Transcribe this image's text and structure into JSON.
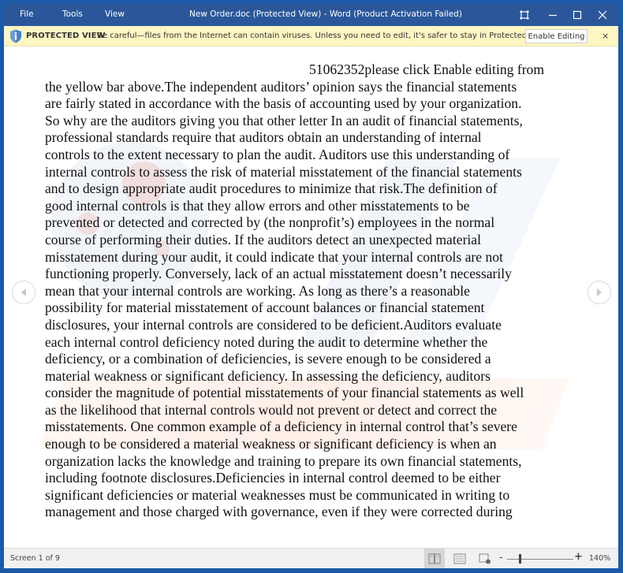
{
  "titlebar": {
    "menu": [
      "File",
      "Tools",
      "View"
    ],
    "title": "New Order.doc (Protected View) - Word (Product Activation Failed)",
    "controls": [
      "fullscreen-icon",
      "minimize-icon",
      "maximize-icon",
      "close-icon"
    ]
  },
  "protected_view": {
    "label": "PROTECTED VIEW",
    "message": "Be careful—files from the Internet can contain viruses. Unless you need to edit, it's safer to stay in Protected View.",
    "enable_button": "Enable Editing",
    "close": "×",
    "color": "#fdf6c3"
  },
  "document": {
    "lines": [
      "51062352please click Enable editing from",
      "the yellow bar above.The independent auditors’ opinion says the financial statements",
      "are fairly stated in accordance with the basis of accounting used by your organization.",
      "So why are the auditors giving you that other letter In an audit of financial statements,",
      "professional standards require that auditors obtain an understanding of internal",
      "controls to the extent necessary to plan the audit. Auditors use this understanding of",
      "internal controls to assess the risk of material misstatement of the financial statements",
      "and to design appropriate audit procedures to minimize that risk.The definition of",
      "good internal controls is that they allow errors and other misstatements to be",
      "prevented or detected and corrected by (the nonprofit’s) employees in the normal",
      "course of performing their duties. If the auditors detect an unexpected material",
      "misstatement during your audit, it could indicate that your internal controls are not",
      "functioning properly. Conversely, lack of an actual misstatement doesn’t necessarily",
      "mean that your internal controls are working. As long as there’s a reasonable",
      "possibility for material misstatement of account balances or financial statement",
      "disclosures, your internal controls are considered to be deficient.Auditors evaluate",
      "each internal control deficiency noted during the audit to determine whether the",
      "deficiency, or a combination of deficiencies, is severe enough to be considered a",
      "material weakness or significant deficiency. In assessing the deficiency, auditors",
      "consider the magnitude of potential misstatements of your financial statements as well",
      "as the likelihood that internal controls would not prevent or detect and correct the",
      "misstatements. One common example of a deficiency in internal control that’s severe",
      "enough to be considered a material weakness or significant deficiency is when an",
      "organization lacks the knowledge and training to prepare its own financial statements,",
      "including footnote disclosures.Deficiencies in internal control deemed to be either",
      "significant deficiencies or material weaknesses must be communicated in writing to",
      "management and those charged with governance, even if they were corrected during"
    ]
  },
  "statusbar": {
    "screen": "Screen 1 of 9",
    "views": [
      "read-mode-icon",
      "print-layout-icon",
      "web-layout-icon"
    ],
    "zoom_minus": "-",
    "zoom_plus": "+",
    "zoom_level": "140%",
    "zoom_fraction": 0.2
  },
  "colors": {
    "titlebar": "#2b579a",
    "frame": "#1c5aa8"
  }
}
